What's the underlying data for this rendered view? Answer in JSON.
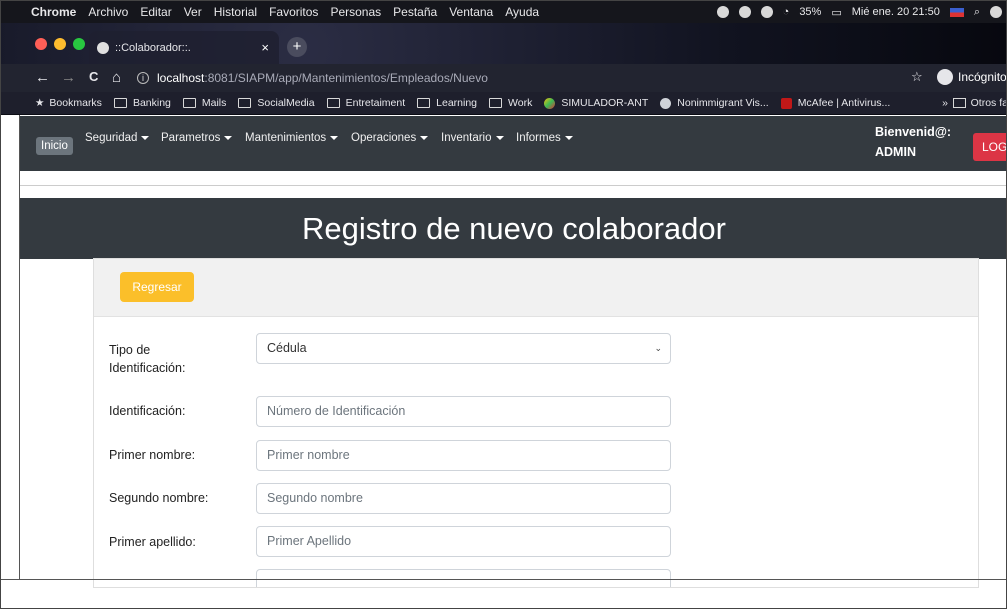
{
  "macbar": {
    "apple": "",
    "menus": [
      "Chrome",
      "Archivo",
      "Editar",
      "Ver",
      "Historial",
      "Favoritos",
      "Personas",
      "Pestaña",
      "Ventana",
      "Ayuda"
    ],
    "battery": "35%",
    "datetime": "Mié ene. 20  21:50"
  },
  "browser": {
    "tab_title": "::Colaborador::.",
    "tab_close": "×",
    "new_tab": "+",
    "back": "←",
    "forward": "→",
    "reload": "C",
    "home": "⌂",
    "info": "i",
    "url_host": "localhost",
    "url_path": ":8081/SIAPM/app/Mantenimientos/Empleados/Nuevo",
    "star": "☆",
    "incognito_label": "Incógnito"
  },
  "bookmarks": {
    "items": [
      "Bookmarks",
      "Banking",
      "Mails",
      "SocialMedia",
      "Entretaiment",
      "Learning",
      "Work",
      "SIMULADOR-ANT",
      "Nonimmigrant Vis...",
      "McAfee | Antivirus..."
    ],
    "more": "»",
    "others": "Otros fa"
  },
  "navbar": {
    "inicio": "Inicio",
    "links": [
      "Seguridad",
      "Parametros",
      "Mantenimientos",
      "Operaciones",
      "Inventario",
      "Informes"
    ],
    "welcome_line1": "Bienvenid@:",
    "welcome_line2": "ADMIN",
    "logout": "LOG"
  },
  "page": {
    "title": "Registro de nuevo colaborador",
    "back_button": "Regresar",
    "form": {
      "tipo_label": "Tipo de Identificación:",
      "tipo_value": "Cédula",
      "identificacion_label": "Identificación:",
      "identificacion_placeholder": "Número de Identificación",
      "primer_nombre_label": "Primer nombre:",
      "primer_nombre_placeholder": "Primer nombre",
      "segundo_nombre_label": "Segundo nombre:",
      "segundo_nombre_placeholder": "Segundo nombre",
      "primer_apellido_label": "Primer apellido:",
      "primer_apellido_placeholder": "Primer Apellido"
    }
  },
  "colors": {
    "navbar": "#343a40",
    "warning": "#fbbf2a",
    "danger": "#dc3545"
  }
}
